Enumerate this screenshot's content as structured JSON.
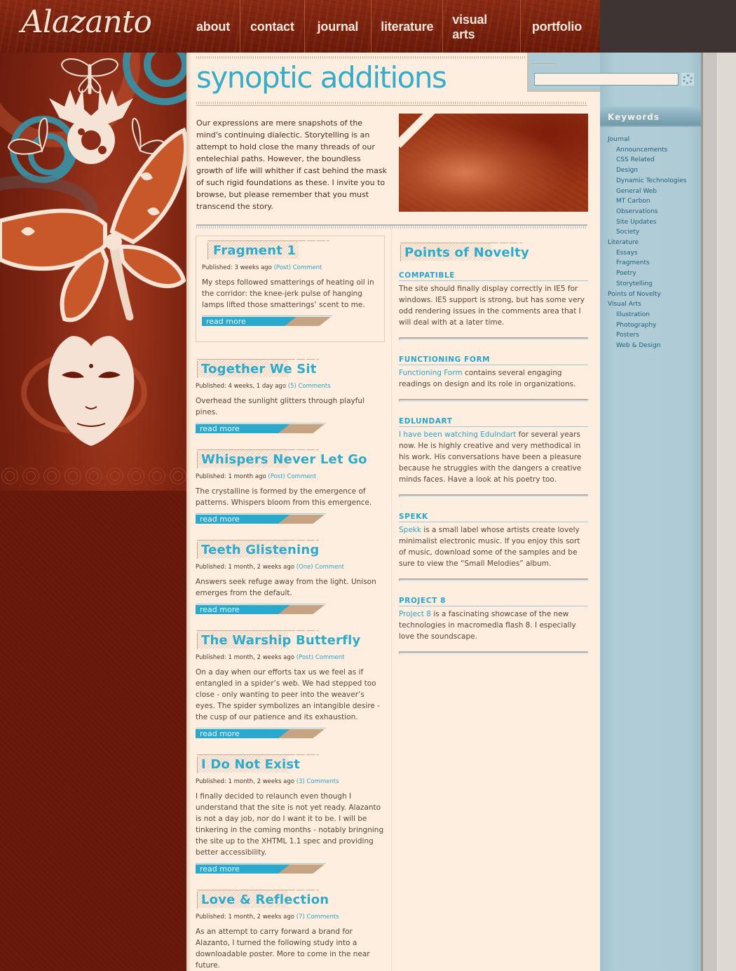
{
  "site": {
    "logo": "Alazanto"
  },
  "nav": {
    "items": [
      {
        "label": "about"
      },
      {
        "label": "contact"
      },
      {
        "label": "journal"
      },
      {
        "label": "literature"
      },
      {
        "label": "visual arts"
      },
      {
        "label": "portfolio"
      }
    ]
  },
  "search": {
    "value": "",
    "placeholder": "",
    "button_icon": "search-flower-icon"
  },
  "page": {
    "title": "synoptic additions",
    "intro": "Our expressions are mere snapshots of the mind's continuing dialectic. Storytelling is an attempt to hold close the many threads of our entelechial paths. However, the boundless growth of life will whither if cast behind the mask of such rigid foundations as these. I invite you to browse, but please remember that you must transcend the story."
  },
  "posts": [
    {
      "title": "Fragment 1",
      "published_label": "Published:",
      "published": "3 weeks ago",
      "comment_count": "(Post)",
      "comment_label": "Comment",
      "body": "My steps followed smatterings of heating oil in the corridor: the knee-jerk pulse of hanging lamps lifted those smatterings’ scent to me.",
      "read_more": "read more"
    },
    {
      "title": "Together We Sit",
      "published_label": "Published:",
      "published": "4 weeks, 1 day ago",
      "comment_count": "(5)",
      "comment_label": "Comments",
      "body": "Overhead the sunlight glitters through playful pines.",
      "read_more": "read more"
    },
    {
      "title": "Whispers Never Let Go",
      "published_label": "Published:",
      "published": "1 month ago",
      "comment_count": "(Post)",
      "comment_label": "Comment",
      "body": "The crystalline is formed by the emergence of patterns. Whispers bloom from this emergence.",
      "read_more": "read more"
    },
    {
      "title": "Teeth Glistening",
      "published_label": "Published:",
      "published": "1 month, 2 weeks ago",
      "comment_count": "(One)",
      "comment_label": "Comment",
      "body": "Answers seek refuge away from the light. Unison emerges from the default.",
      "read_more": "read more"
    },
    {
      "title": "The Warship Butterfly",
      "published_label": "Published:",
      "published": "1 month, 2 weeks ago",
      "comment_count": "(Post)",
      "comment_label": "Comment",
      "body": "On a day when our efforts tax us we feel as if entangled in a spider’s web. We had stepped too close - only wanting to peer into the weaver’s eyes. The spider symbolizes an intangible desire - the cusp of our patience and its exhaustion.",
      "read_more": "read more"
    },
    {
      "title": "I Do Not Exist",
      "published_label": "Published:",
      "published": "1 month, 2 weeks ago",
      "comment_count": "(3)",
      "comment_label": "Comments",
      "body": "I finally decided to relaunch even though I understand that the site is not yet ready. Alazanto is not a day job, nor do I want it to be. I will be tinkering in the coming months - notably bringning the site up to the XHTML 1.1 spec and providing better accessibility.",
      "read_more": "read more"
    },
    {
      "title": "Love & Reflection",
      "published_label": "Published:",
      "published": "1 month, 2 weeks ago",
      "comment_count": "(7)",
      "comment_label": "Comments",
      "body": "As an attempt to carry forward a brand for Alazanto, I turned the following study into a downloadable poster. More to come in the near future.",
      "read_more": ""
    }
  ],
  "points_of_novelty": {
    "title": "Points of Novelty",
    "items": [
      {
        "title": "COMPATIBLE",
        "link": "",
        "body": "The site should finally display correctly in IE5 for windows. IE5 support is strong, but has some very odd rendering issues in the comments area that I will deal with at a later time."
      },
      {
        "title": "FUNCTIONING FORM",
        "link": "Functioning Form",
        "body": " contains several engaging readings on design and its role in organizations."
      },
      {
        "title": "EDLUNDART",
        "link": "I have been watching Edulndart",
        "body": " for several years now. He is highly creative and very methodical in his work. His conversations have been a pleasure because he struggles with the dangers a creative minds faces. Have a look at his poetry too."
      },
      {
        "title": "SPEKK",
        "link": "Spekk",
        "body": " is a small label whose artists create lovely minimalist electronic music. If you enjoy this sort of music, download some of the samples and be sure to view the “Small Melodies” album."
      },
      {
        "title": "PROJECT 8",
        "link": "Project 8",
        "body": " is a fascinating showcase of the new technologies in macromedia flash 8. I especially love the soundscape."
      }
    ]
  },
  "keywords": {
    "title": "Keywords",
    "items": [
      {
        "label": "Journal",
        "level": 0
      },
      {
        "label": "Announcements",
        "level": 1
      },
      {
        "label": "CSS Related",
        "level": 1
      },
      {
        "label": "Design",
        "level": 1
      },
      {
        "label": "Dynamic Technologies",
        "level": 1
      },
      {
        "label": "General Web",
        "level": 1
      },
      {
        "label": "MT Carbon",
        "level": 1
      },
      {
        "label": "Observations",
        "level": 1
      },
      {
        "label": "Site Updates",
        "level": 1
      },
      {
        "label": "Society",
        "level": 1
      },
      {
        "label": "Literature",
        "level": 0
      },
      {
        "label": "Essays",
        "level": 1
      },
      {
        "label": "Fragments",
        "level": 1
      },
      {
        "label": "Poetry",
        "level": 1
      },
      {
        "label": "Storytelling",
        "level": 1
      },
      {
        "label": "Points of Novelty",
        "level": 0
      },
      {
        "label": "Visual Arts",
        "level": 0
      },
      {
        "label": "Illustration",
        "level": 1
      },
      {
        "label": "Photography",
        "level": 1
      },
      {
        "label": "Posters",
        "level": 1
      },
      {
        "label": "Web & Design",
        "level": 1
      }
    ]
  },
  "colors": {
    "accent_blue": "#2eaacb",
    "rust": "#7d2412",
    "paper": "#fdeee0",
    "sidebar": "#afccd6",
    "tan": "#c6a483"
  }
}
